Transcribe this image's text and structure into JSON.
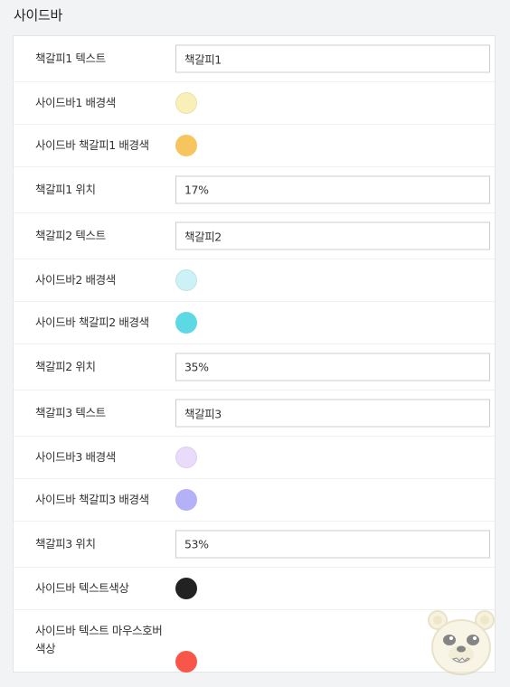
{
  "section": {
    "title": "사이드바"
  },
  "rows": [
    {
      "label": "책갈피1 텍스트",
      "value": "책갈피1"
    },
    {
      "label": "사이드바1 배경색",
      "color": "#f9f0b8"
    },
    {
      "label": "사이드바 책갈피1 배경색",
      "color": "#f7c55d"
    },
    {
      "label": "책갈피1 위치",
      "value": "17%"
    },
    {
      "label": "책갈피2 텍스트",
      "value": "책갈피2"
    },
    {
      "label": "사이드바2 배경색",
      "color": "#ccf1f6"
    },
    {
      "label": "사이드바 책갈피2 배경색",
      "color": "#5cd9e5"
    },
    {
      "label": "책갈피2 위치",
      "value": "35%"
    },
    {
      "label": "책갈피3 텍스트",
      "value": "책갈피3"
    },
    {
      "label": "사이드바3 배경색",
      "color": "#e9dcfb"
    },
    {
      "label": "사이드바 책갈피3 배경색",
      "color": "#b5b1f8"
    },
    {
      "label": "책갈피3 위치",
      "value": "53%"
    },
    {
      "label": "사이드바 텍스트색상",
      "color": "#222222"
    },
    {
      "label": "사이드바 텍스트 마우스호버 색상",
      "color": "#f9564a"
    }
  ],
  "icons": {
    "watermark": "bear-face-icon"
  }
}
